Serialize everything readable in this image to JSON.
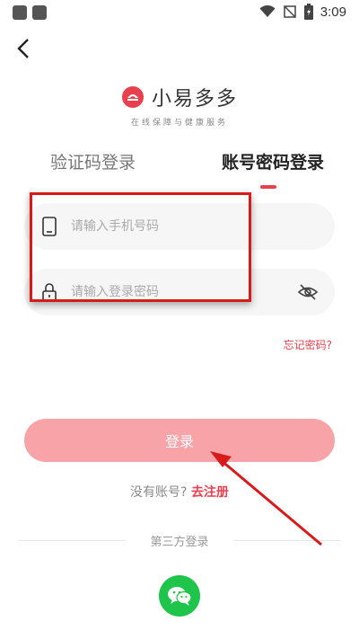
{
  "status_bar": {
    "time": "3:09"
  },
  "app": {
    "name": "小易多多",
    "tagline": "在线保障与健康服务"
  },
  "tabs": {
    "sms_login": "验证码登录",
    "password_login": "账号密码登录",
    "active": "password_login"
  },
  "form": {
    "phone_placeholder": "请输入手机号码",
    "password_placeholder": "请输入登录密码",
    "phone_value": "",
    "password_value": "",
    "forgot_password": "忘记密码?"
  },
  "login_button": "登录",
  "register": {
    "question": "没有账号?",
    "link": "去注册"
  },
  "third_party": {
    "label": "第三方登录",
    "options": [
      "wechat-icon"
    ]
  },
  "colors": {
    "accent": "#e8414d",
    "login_button": "#f7a3a8",
    "wechat": "#1fc44a",
    "annotation": "#d71a1a"
  }
}
